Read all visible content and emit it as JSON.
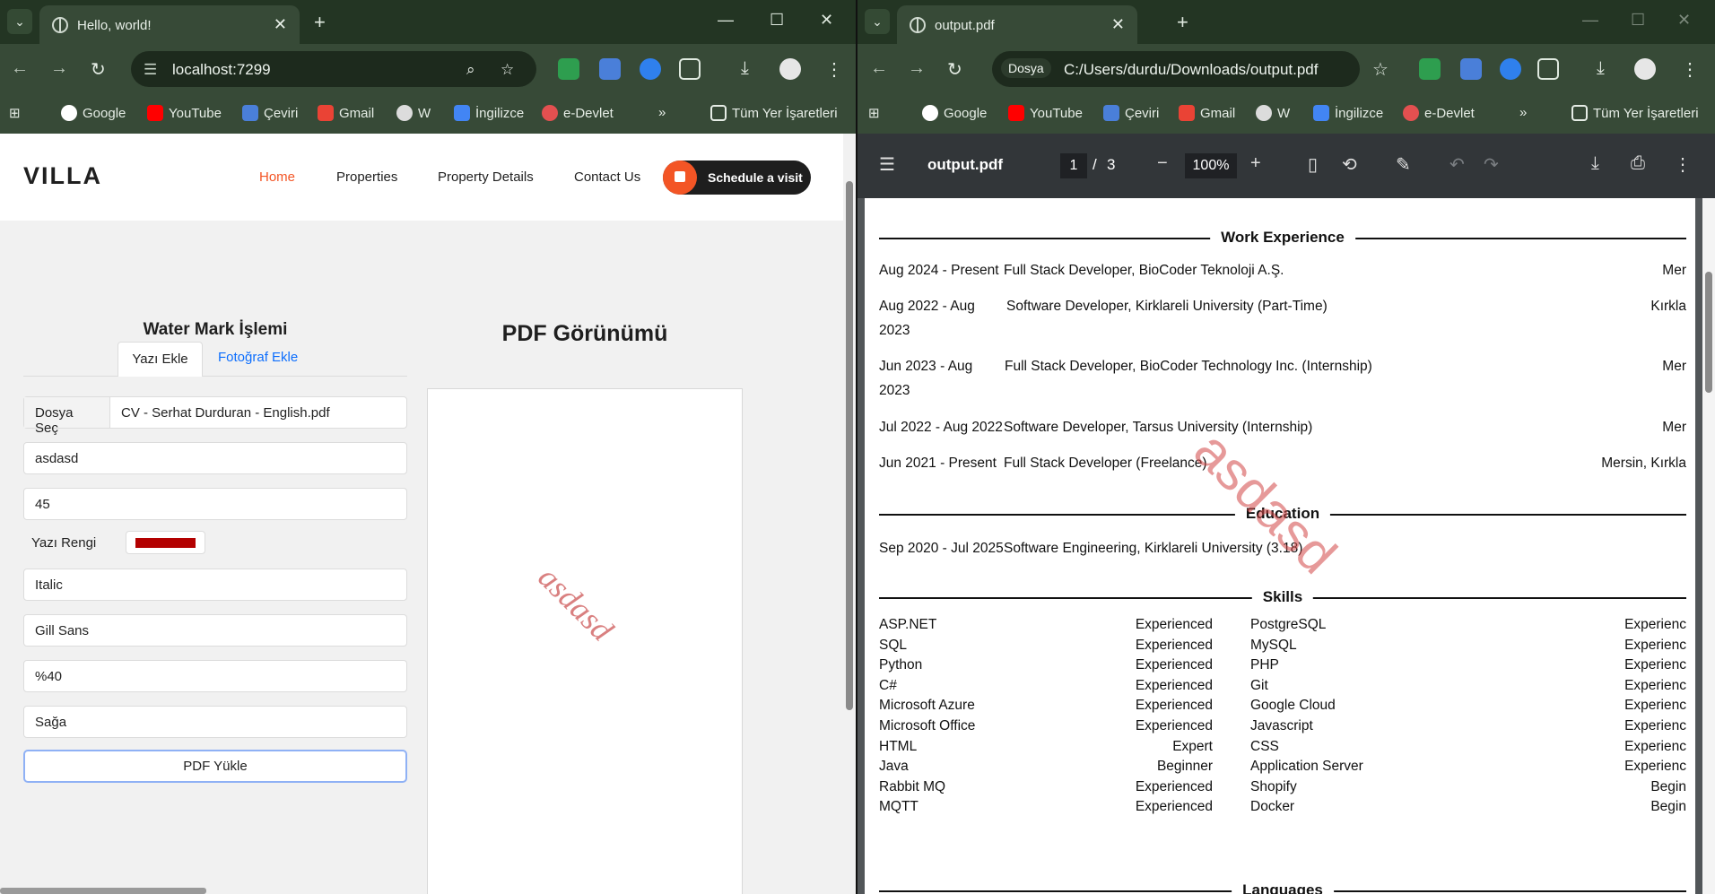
{
  "left_window": {
    "tab_title": "Hello, world!",
    "url": "localhost:7299",
    "bookmarks": [
      "Google",
      "YouTube",
      "Çeviri",
      "Gmail",
      "W",
      "İngilizce",
      "e-Devlet"
    ],
    "bookmarks_folder": "Tüm Yer İşaretleri"
  },
  "right_window": {
    "tab_title": "output.pdf",
    "url_badge": "Dosya",
    "url": "C:/Users/durdu/Downloads/output.pdf",
    "bookmarks": [
      "Google",
      "YouTube",
      "Çeviri",
      "Gmail",
      "W",
      "İngilizce",
      "e-Devlet"
    ],
    "bookmarks_folder": "Tüm Yer İşaretleri"
  },
  "site": {
    "logo": "VILLA",
    "nav": [
      "Home",
      "Properties",
      "Property Details",
      "Contact Us"
    ],
    "cta": "Schedule a visit"
  },
  "form": {
    "heading": "Water Mark İşlemi",
    "tabs": [
      "Yazı Ekle",
      "Fotoğraf Ekle"
    ],
    "file_label": "Dosya Seç",
    "file_name": "CV - Serhat Durduran - English.pdf",
    "text_value": "asdasd",
    "angle_value": "45",
    "color_label": "Yazı Rengi",
    "color": "#b30000",
    "style_value": "Italic",
    "font_value": "Gill Sans",
    "opacity_value": "%40",
    "position_value": "Sağa",
    "submit_label": "PDF Yükle"
  },
  "preview": {
    "title": "PDF Görünümü",
    "watermark": "asdasd"
  },
  "pdf": {
    "file_name": "output.pdf",
    "page_current": "1",
    "page_sep": "/",
    "page_total": "3",
    "zoom": "100%",
    "watermark": "asdasd",
    "sections": {
      "work": "Work Experience",
      "education": "Education",
      "skills": "Skills",
      "languages": "Languages"
    },
    "work": [
      {
        "date": "Aug 2024 - Present",
        "role": "Full Stack Developer, BioCoder Teknoloji A.Ş.",
        "loc": "Mer"
      },
      {
        "date": "Aug 2022 - Aug",
        "date2": "2023",
        "role": "Software Developer, Kirklareli University (Part-Time)",
        "loc": "Kırkla"
      },
      {
        "date": "Jun 2023 - Aug",
        "date2": "2023",
        "role": "Full Stack Developer, BioCoder Technology Inc. (Internship)",
        "loc": "Mer"
      },
      {
        "date": "Jul 2022 - Aug 2022",
        "role": "Software Developer, Tarsus University (Internship)",
        "loc": "Mer"
      },
      {
        "date": "Jun 2021 - Present",
        "role": "Full Stack Developer (Freelance)",
        "loc": "Mersin, Kırkla"
      }
    ],
    "education": [
      {
        "date": "Sep 2020 - Jul 2025",
        "desc": "Software Engineering, Kirklareli University (3.18)"
      }
    ],
    "skills_left": [
      {
        "name": "ASP.NET",
        "level": "Experienced"
      },
      {
        "name": "SQL",
        "level": "Experienced"
      },
      {
        "name": "Python",
        "level": "Experienced"
      },
      {
        "name": "C#",
        "level": "Experienced"
      },
      {
        "name": "Microsoft Azure",
        "level": "Experienced"
      },
      {
        "name": "Microsoft Office",
        "level": "Experienced"
      },
      {
        "name": "HTML",
        "level": "Expert"
      },
      {
        "name": "Java",
        "level": "Beginner"
      },
      {
        "name": "Rabbit MQ",
        "level": "Experienced"
      },
      {
        "name": "MQTT",
        "level": "Experienced"
      }
    ],
    "skills_right": [
      {
        "name": "PostgreSQL",
        "level": "Experienc"
      },
      {
        "name": "MySQL",
        "level": "Experienc"
      },
      {
        "name": "PHP",
        "level": "Experienc"
      },
      {
        "name": "Git",
        "level": "Experienc"
      },
      {
        "name": "Google Cloud",
        "level": "Experienc"
      },
      {
        "name": "Javascript",
        "level": "Experienc"
      },
      {
        "name": "CSS",
        "level": "Experienc"
      },
      {
        "name": "Application Server",
        "level": "Experienc"
      },
      {
        "name": "Shopify",
        "level": "Begin"
      },
      {
        "name": "Docker",
        "level": "Begin"
      }
    ]
  }
}
